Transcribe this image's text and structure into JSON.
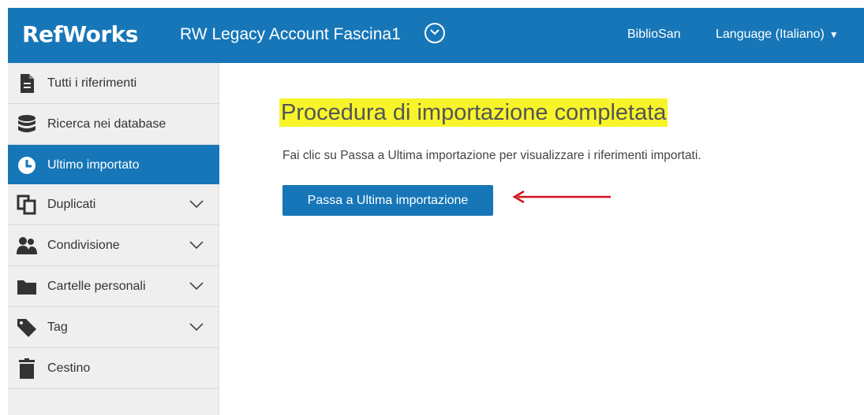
{
  "header": {
    "brand": "RefWorks",
    "account_name": "RW Legacy Account Fascina1",
    "user": "BiblioSan",
    "language": "Language (Italiano)",
    "color": "#1676b8"
  },
  "sidebar": {
    "items": [
      {
        "label": "Tutti i riferimenti",
        "icon": "document-icon"
      },
      {
        "label": "Ricerca nei database",
        "icon": "database-icon"
      },
      {
        "label": "Ultimo importato",
        "icon": "clock-icon",
        "active": true
      },
      {
        "label": "Duplicati",
        "icon": "duplicate-icon",
        "expandable": true
      },
      {
        "label": "Condivisione",
        "icon": "users-icon",
        "expandable": true
      },
      {
        "label": "Cartelle personali",
        "icon": "folder-icon",
        "expandable": true
      },
      {
        "label": "Tag",
        "icon": "tag-icon",
        "expandable": true
      },
      {
        "label": "Cestino",
        "icon": "trash-icon"
      }
    ]
  },
  "main": {
    "title": "Procedura di importazione completata",
    "description": "Fai clic su Passa a Ultima importazione per visualizzare i riferimenti importati.",
    "button_label": "Passa a Ultima importazione",
    "highlight_color": "#f7f52a",
    "annotation_color": "#d0101a"
  }
}
